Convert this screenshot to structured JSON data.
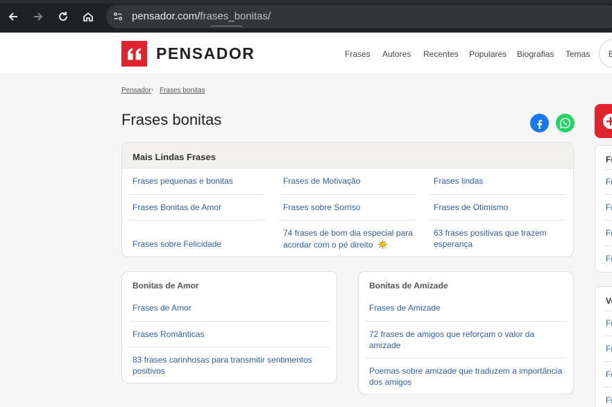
{
  "browser": {
    "url_domain": "pensador.com/",
    "url_path": "frases_bonitas/"
  },
  "site": {
    "logo_text": "PENSADOR",
    "menu": [
      "Frases",
      "Autores",
      "Recentes",
      "Populares",
      "Biografias",
      "Temas"
    ],
    "header_button": "B"
  },
  "breadcrumb": [
    "Pensador",
    "Frases bonitas"
  ],
  "page_title": "Frases bonitas",
  "main_card": {
    "title": "Mais Lindas Frases",
    "col1": [
      "Frases pequenas e bonitas",
      "Frases Bonitas de Amor",
      "Frases sobre Felicidade"
    ],
    "col2": [
      "Frases de Motivação",
      "Frases sobre Sorriso",
      "74 frases de bom dia especial para",
      "acordar com o pé direito"
    ],
    "col3": [
      "Frases lindas",
      "Frases de Otimismo",
      "63 frases positivas que trazem",
      "esperança"
    ]
  },
  "amor_card": {
    "title": "Bonitas de Amor",
    "links": [
      "Frases de Amor",
      "Frases Românticas",
      "83 frases carinhosas para transmitir sentimentos",
      "positivos"
    ]
  },
  "amizade_card": {
    "title": "Bonitas de Amizade",
    "links": [
      "Frases de Amizade",
      "72 frases de amigos que reforçam o valor da",
      "amizade",
      "Poemas sobre amizade que traduzem a importância",
      "dos amigos"
    ]
  },
  "sidebar": {
    "card1_head": "Fr",
    "card1_items": [
      "Fr",
      "Fr",
      "Fr",
      "Fr"
    ],
    "card2_head": "Ve",
    "card2_items": [
      "Fr",
      "Fr",
      "Fr",
      "Fr"
    ]
  },
  "colors": {
    "brand": "#e1232d",
    "link": "#2d5fa8"
  }
}
